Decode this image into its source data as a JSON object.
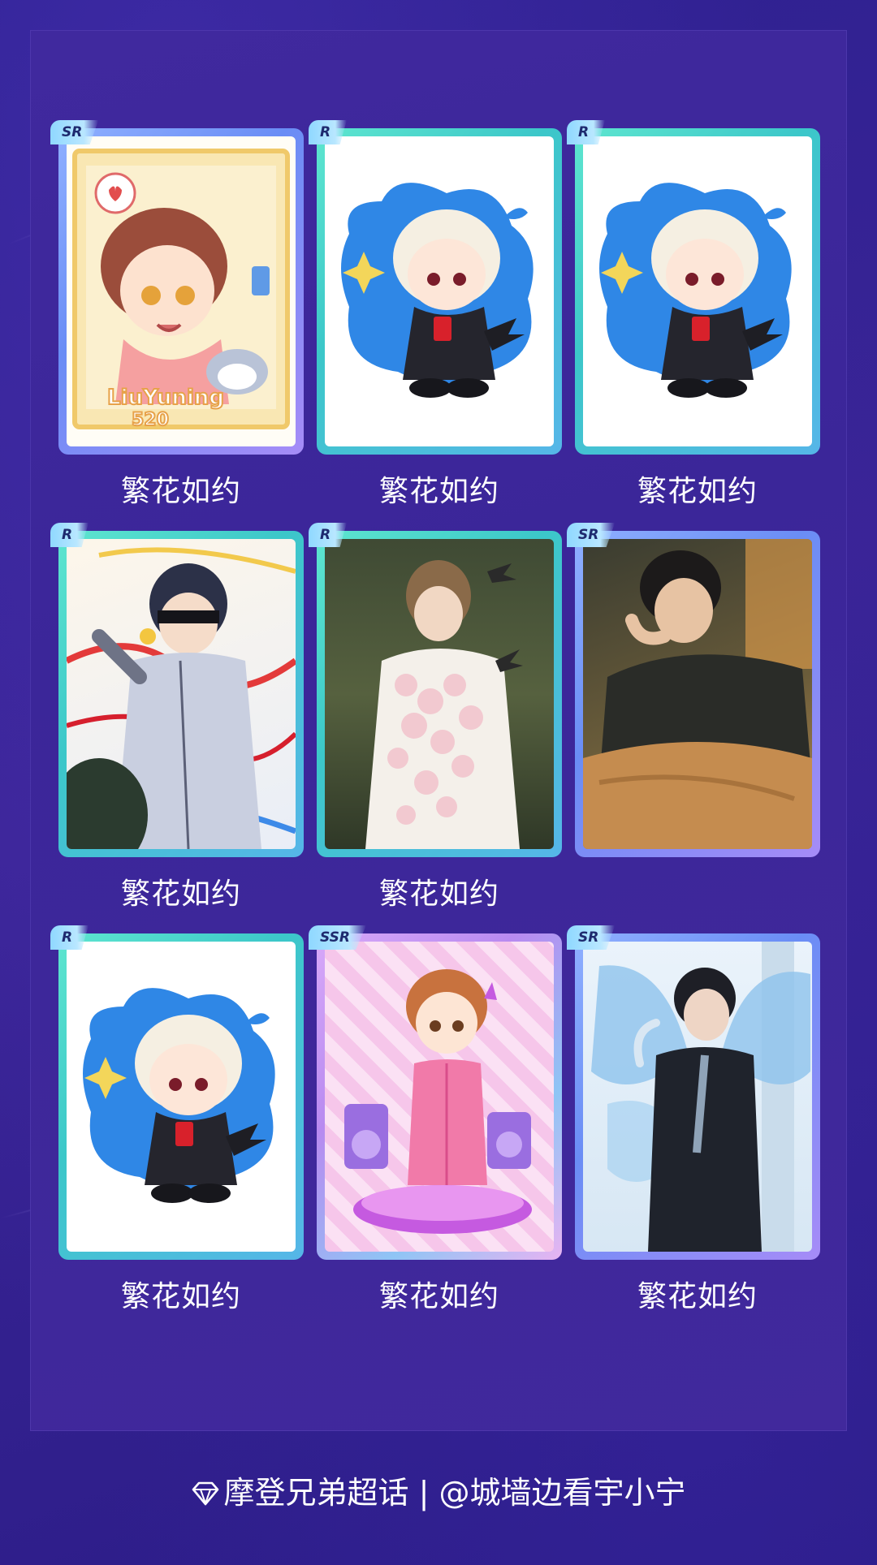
{
  "cards": [
    {
      "rarity": "SR",
      "caption": "繁花如约",
      "art": "chibi-brown-hair-polaroid"
    },
    {
      "rarity": "R",
      "caption": "繁花如约",
      "art": "chibi-blonde-blue-splash"
    },
    {
      "rarity": "R",
      "caption": "繁花如约",
      "art": "chibi-blonde-blue-splash"
    },
    {
      "rarity": "R",
      "caption": "繁花如约",
      "art": "blindfold-ribbons"
    },
    {
      "rarity": "R",
      "caption": "繁花如约",
      "art": "floral-forest"
    },
    {
      "rarity": "SR",
      "caption": "",
      "art": "sweater-portrait"
    },
    {
      "rarity": "R",
      "caption": "繁花如约",
      "art": "chibi-blonde-blue-splash"
    },
    {
      "rarity": "SSR",
      "caption": "繁花如约",
      "art": "chibi-pink-stage"
    },
    {
      "rarity": "SR",
      "caption": "繁花如约",
      "art": "butterfly-wings-suit"
    }
  ],
  "footer": {
    "icon": "diamond-icon",
    "text": "摩登兄弟超话 | @城墙边看宇小宁"
  },
  "colors": {
    "background": "#2a1c86",
    "panel": "#3b2699",
    "frame_teal": "#3cc7c9",
    "frame_sr": "#6a8df5",
    "frame_ssr": "#b88af0"
  }
}
